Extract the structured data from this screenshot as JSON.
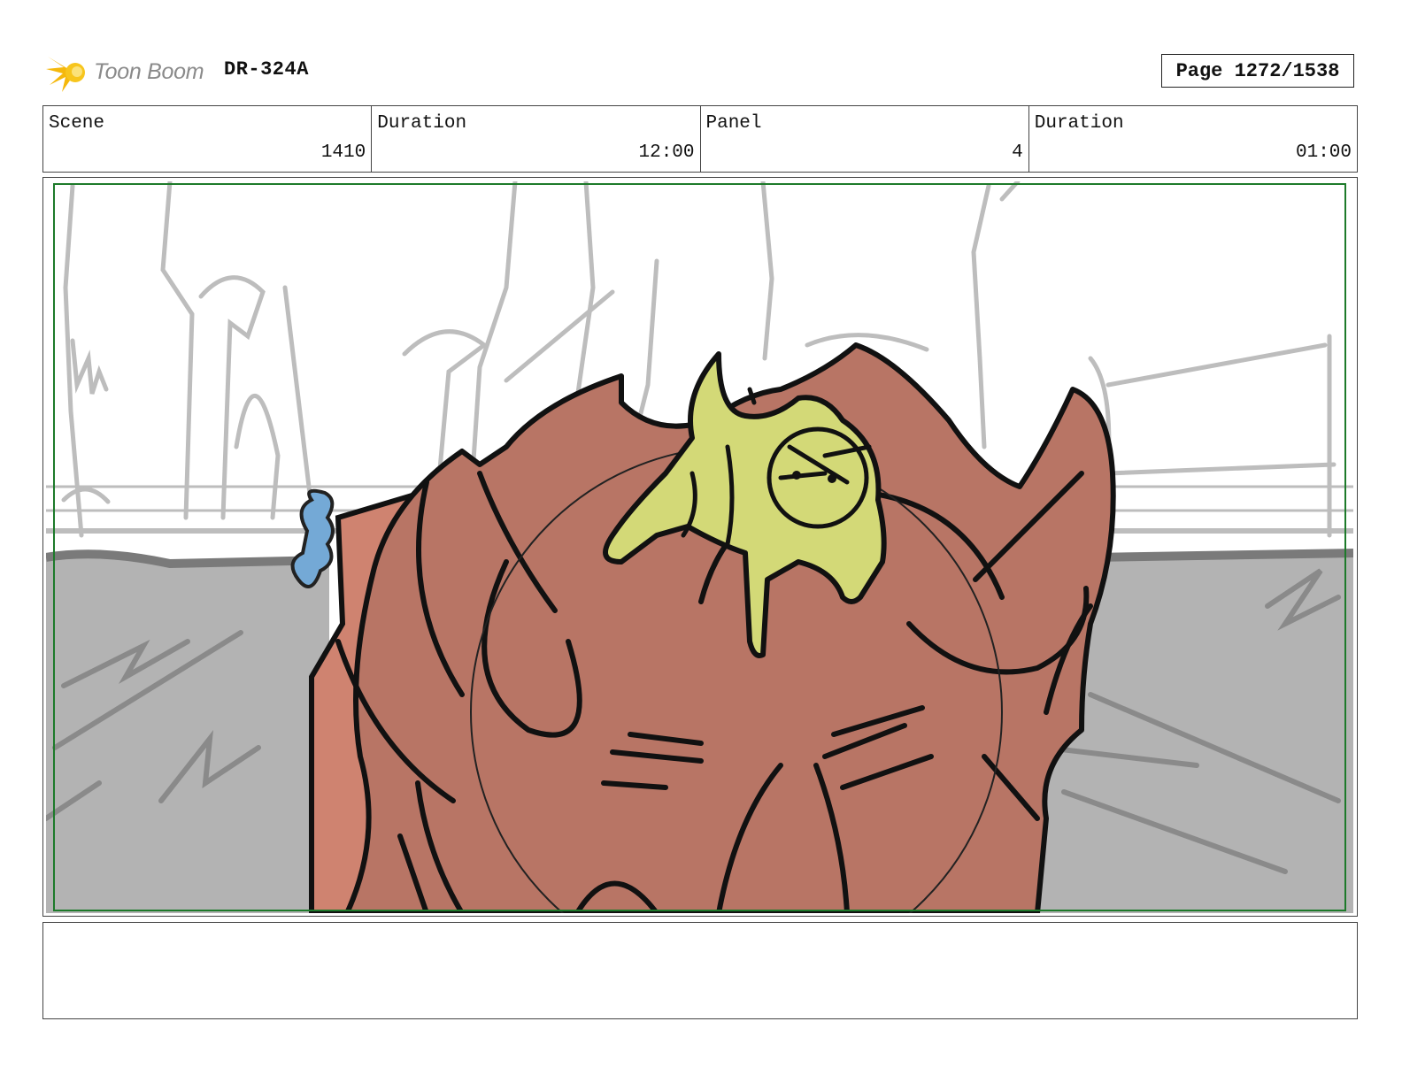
{
  "header": {
    "logo_text": "Toon Boom",
    "logo_icon": "starburst-logo-icon",
    "document_id": "DR-324A",
    "page_label": "Page 1272/1538"
  },
  "info": {
    "scene_label": "Scene",
    "scene_value": "1410",
    "scene_duration_label": "Duration",
    "scene_duration_value": "12:00",
    "panel_label": "Panel",
    "panel_value": "4",
    "panel_duration_label": "Duration",
    "panel_duration_value": "01:00"
  },
  "panel": {
    "colors": {
      "sky": "#ffffff",
      "ground": "#b3b3b3",
      "character_skin": "#b87565",
      "character_highlight": "#cf8370",
      "creature": "#d3d977",
      "blue_creature": "#74a9d6",
      "safe_frame": "#1d7a2a",
      "ink": "#111111",
      "sketch": "#bdbdbd"
    }
  },
  "notes": {
    "text": ""
  }
}
